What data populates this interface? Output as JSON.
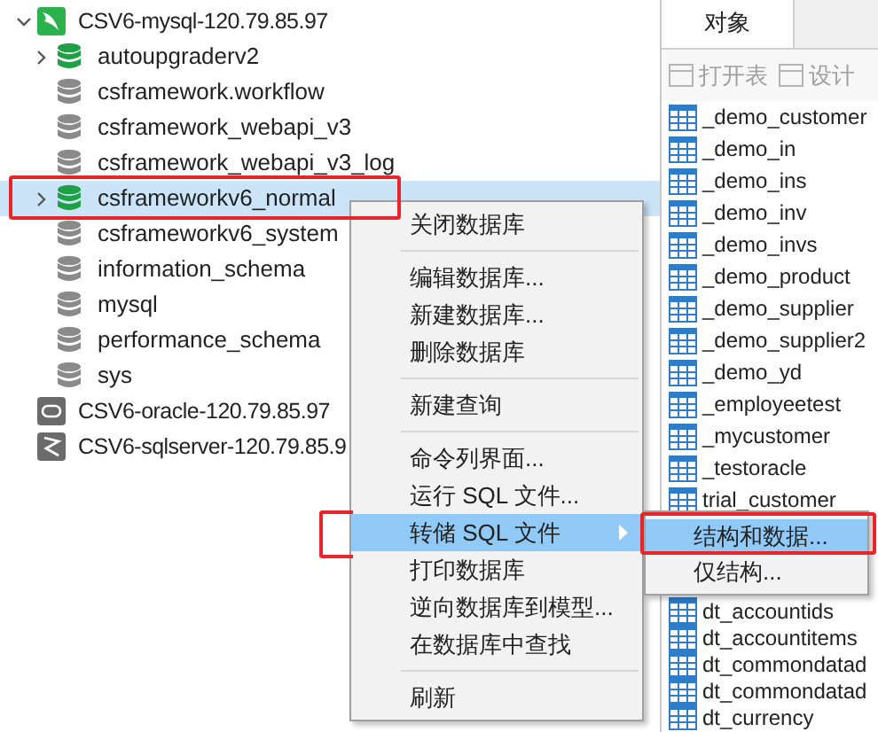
{
  "tree": [
    {
      "name": "CSV6-mysql-120.79.85.97",
      "kind": "mysql",
      "expanded": true,
      "databases": [
        {
          "name": "autoupgraderv2",
          "open": true,
          "selected": false
        },
        {
          "name": "csframework.workflow",
          "open": false,
          "selected": false
        },
        {
          "name": "csframework_webapi_v3",
          "open": false,
          "selected": false
        },
        {
          "name": "csframework_webapi_v3_log",
          "open": false,
          "selected": false
        },
        {
          "name": "csframeworkv6_normal",
          "open": true,
          "selected": true
        },
        {
          "name": "csframeworkv6_system",
          "open": false,
          "selected": false
        },
        {
          "name": "information_schema",
          "open": false,
          "selected": false
        },
        {
          "name": "mysql",
          "open": false,
          "selected": false
        },
        {
          "name": "performance_schema",
          "open": false,
          "selected": false
        },
        {
          "name": "sys",
          "open": false,
          "selected": false
        }
      ]
    },
    {
      "name": "CSV6-oracle-120.79.85.97",
      "kind": "oracle"
    },
    {
      "name": "CSV6-sqlserver-120.79.85.9",
      "kind": "sqlserver"
    }
  ],
  "objects_tab": {
    "label": "对象",
    "selected": true
  },
  "toolbar": [
    {
      "label": "打开表",
      "disabled": true
    },
    {
      "label": "设计",
      "disabled": true
    }
  ],
  "tables": [
    {
      "name": "_demo_customer"
    },
    {
      "name": "_demo_in"
    },
    {
      "name": "_demo_ins"
    },
    {
      "name": "_demo_inv"
    },
    {
      "name": "_demo_invs"
    },
    {
      "name": "_demo_product"
    },
    {
      "name": "_demo_supplier"
    },
    {
      "name": "_demo_supplier2"
    },
    {
      "name": "_demo_yd"
    },
    {
      "name": "_employeetest"
    },
    {
      "name": "_mycustomer"
    },
    {
      "name": "_testoracle"
    },
    {
      "name": "trial_customer"
    }
  ],
  "tables_below": [
    {
      "name": "dt_accountids"
    },
    {
      "name": "dt_accountitems"
    },
    {
      "name": "dt_commondatad"
    },
    {
      "name": "dt_commondatad"
    },
    {
      "name": "dt_currency"
    }
  ],
  "context_menu": [
    {
      "kind": "item",
      "label": "关闭数据库",
      "selected": false,
      "submenu": false
    },
    {
      "kind": "separator"
    },
    {
      "kind": "item",
      "label": "编辑数据库...",
      "selected": false,
      "submenu": false
    },
    {
      "kind": "item",
      "label": "新建数据库...",
      "selected": false,
      "submenu": false
    },
    {
      "kind": "item",
      "label": "删除数据库",
      "selected": false,
      "submenu": false
    },
    {
      "kind": "separator"
    },
    {
      "kind": "item",
      "label": "新建查询",
      "selected": false,
      "submenu": false
    },
    {
      "kind": "separator"
    },
    {
      "kind": "item",
      "label": "命令列界面...",
      "selected": false,
      "submenu": false
    },
    {
      "kind": "item",
      "label": "运行 SQL 文件...",
      "selected": false,
      "submenu": false
    },
    {
      "kind": "item",
      "label": "转储 SQL 文件",
      "selected": true,
      "submenu": true
    },
    {
      "kind": "item",
      "label": "打印数据库",
      "selected": false,
      "submenu": false
    },
    {
      "kind": "item",
      "label": "逆向数据库到模型...",
      "selected": false,
      "submenu": false
    },
    {
      "kind": "item",
      "label": "在数据库中查找",
      "selected": false,
      "submenu": false
    },
    {
      "kind": "separator"
    },
    {
      "kind": "item",
      "label": "刷新",
      "selected": false,
      "submenu": false
    }
  ],
  "submenu": [
    {
      "label": "结构和数据...",
      "selected": true
    },
    {
      "label": "仅结构...",
      "selected": false
    }
  ]
}
